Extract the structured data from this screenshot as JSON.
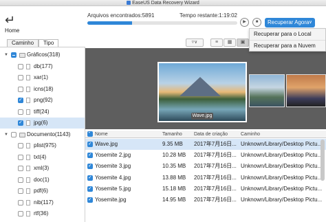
{
  "window": {
    "title": "EaseUS Data Recovery Wizard"
  },
  "home": {
    "label": "Home",
    "icon": "back-arrow-icon"
  },
  "scan": {
    "files_found_label": "Arquivos encontrados:5891",
    "time_remaining_label": "Tempo restante:1:19:02",
    "progress": 0.3,
    "accent_color": "#2f87d8"
  },
  "actions": {
    "play_icon": "play-icon",
    "stop_icon": "stop-icon",
    "recover_now_label": "Recuperar Agora",
    "menu": [
      "Recuperar para o Local",
      "Recuperar para a Nuvem"
    ]
  },
  "tabs": [
    "Caminho",
    "Tipo"
  ],
  "tree": [
    {
      "label": "Gráficos(318)",
      "level": 0,
      "state": "partial",
      "expanded": true
    },
    {
      "label": "db(177)",
      "level": 1,
      "state": "off"
    },
    {
      "label": "xar(1)",
      "level": 1,
      "state": "off"
    },
    {
      "label": "icns(18)",
      "level": 1,
      "state": "off"
    },
    {
      "label": "png(92)",
      "level": 1,
      "state": "on"
    },
    {
      "label": "tiff(24)",
      "level": 1,
      "state": "off"
    },
    {
      "label": "jpg(6)",
      "level": 1,
      "state": "on",
      "selected": true
    },
    {
      "label": "Documento(1143)",
      "level": 0,
      "state": "off",
      "expanded": true
    },
    {
      "label": "plist(975)",
      "level": 1,
      "state": "off"
    },
    {
      "label": "txt(4)",
      "level": 1,
      "state": "off"
    },
    {
      "label": "xml(3)",
      "level": 1,
      "state": "off"
    },
    {
      "label": "doc(1)",
      "level": 1,
      "state": "off"
    },
    {
      "label": "pdf(6)",
      "level": 1,
      "state": "off"
    },
    {
      "label": "nib(117)",
      "level": 1,
      "state": "off"
    },
    {
      "label": "rtf(36)",
      "level": 1,
      "state": "off"
    }
  ],
  "view_icons": [
    "filter-icon",
    "list-view-icon",
    "grid-view-icon",
    "preview-view-icon"
  ],
  "preview": {
    "caption": "Wave.jpg"
  },
  "table": {
    "columns": [
      "Nome",
      "Tamanho",
      "Data de criação",
      "Caminho"
    ],
    "rows": [
      {
        "name": "Wave.jpg",
        "size": "9.35 MB",
        "date": "2017年7月16日...",
        "path": "Unknown/Library/Desktop Pictu..."
      },
      {
        "name": "Yosemite 2.jpg",
        "size": "10.28 MB",
        "date": "2017年7月16日...",
        "path": "Unknown/Library/Desktop Pictu..."
      },
      {
        "name": "Yosemite 3.jpg",
        "size": "10.35 MB",
        "date": "2017年7月16日...",
        "path": "Unknown/Library/Desktop Pictu..."
      },
      {
        "name": "Yosemite 4.jpg",
        "size": "13.88 MB",
        "date": "2017年7月16日...",
        "path": "Unknown/Library/Desktop Pictu..."
      },
      {
        "name": "Yosemite 5.jpg",
        "size": "15.18 MB",
        "date": "2017年7月16日...",
        "path": "Unknown/Library/Desktop Pictu..."
      },
      {
        "name": "Yosemite.jpg",
        "size": "14.95 MB",
        "date": "2017年7月16日...",
        "path": "Unknown/Library/Desktop Pictu..."
      }
    ]
  }
}
